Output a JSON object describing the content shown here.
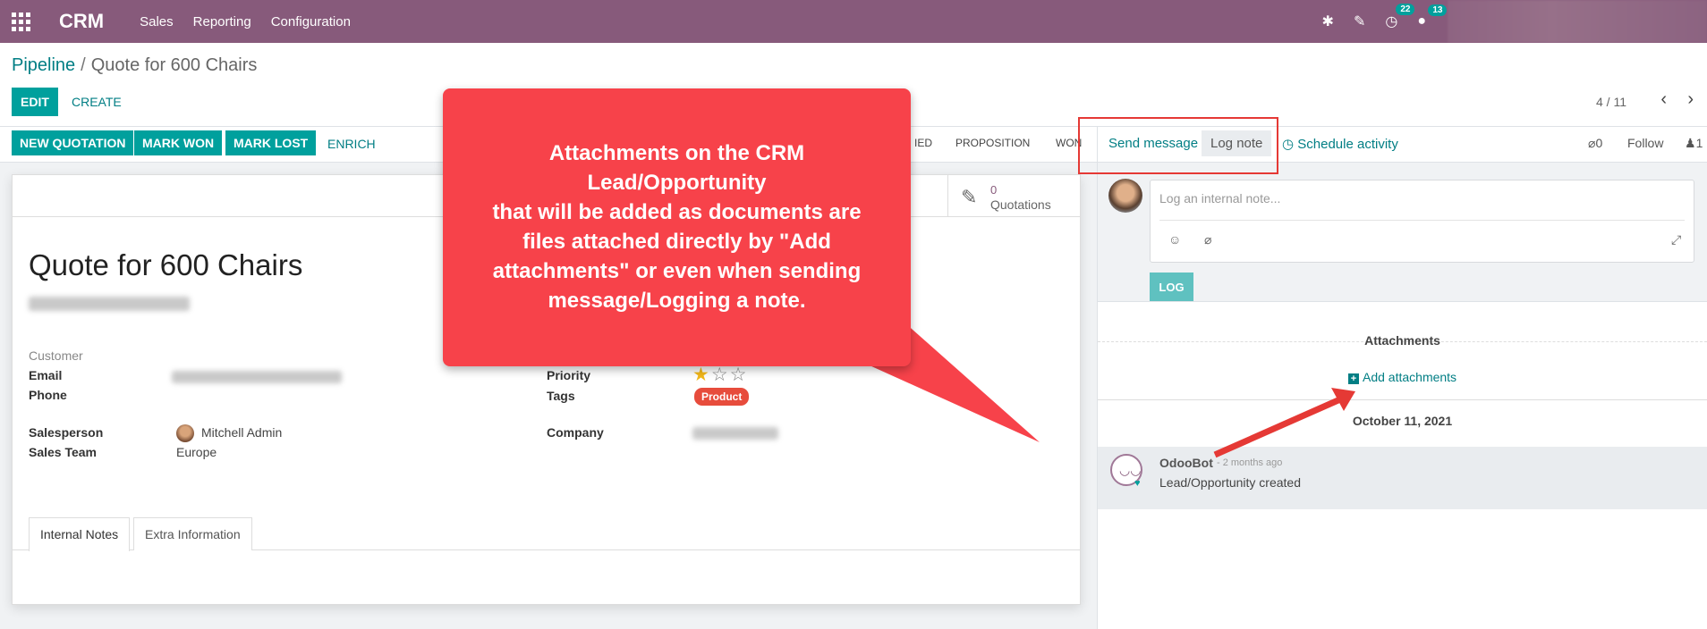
{
  "topnav": {
    "app_title": "CRM",
    "menu": [
      "Sales",
      "Reporting",
      "Configuration"
    ],
    "activity_count": "22",
    "message_count": "13"
  },
  "control": {
    "breadcrumb_parent": "Pipeline",
    "breadcrumb_current": "Quote for 600 Chairs",
    "edit_label": "EDIT",
    "create_label": "CREATE",
    "pager": "4 / 11"
  },
  "actions": {
    "new_quotation": "NEW QUOTATION",
    "mark_won": "MARK WON",
    "mark_lost": "MARK LOST",
    "enrich": "ENRICH"
  },
  "stages": [
    "IED",
    "PROPOSITION",
    "WON"
  ],
  "form": {
    "smart_button": {
      "count": "0",
      "label": "Quotations"
    },
    "title": "Quote for 600 Chairs",
    "customer_label": "Customer",
    "email_label": "Email",
    "phone_label": "Phone",
    "salesperson_label": "Salesperson",
    "salesperson_value": "Mitchell Admin",
    "sales_team_label": "Sales Team",
    "sales_team_value": "Europe",
    "priority_label": "Priority",
    "tags_label": "Tags",
    "tag_value": "Product",
    "company_label": "Company",
    "priority_stars": 1,
    "tabs": [
      "Internal Notes",
      "Extra Information"
    ]
  },
  "chatter": {
    "send_message": "Send message",
    "log_note": "Log note",
    "schedule_activity": "Schedule activity",
    "attachment_count": "0",
    "follow": "Follow",
    "follower_count": "1",
    "placeholder": "Log an internal note...",
    "log_button": "LOG",
    "attachments_title": "Attachments",
    "add_attachments": "Add attachments",
    "date": "October 11, 2021",
    "message": {
      "author": "OdooBot",
      "time": "- 2 months ago",
      "body": "Lead/Opportunity created"
    }
  },
  "annotation": {
    "lines": [
      "Attachments on the CRM",
      "Lead/Opportunity",
      "that will be added as documents are",
      "files attached directly by \"Add",
      "attachments\" or even when sending",
      "message/Logging a note."
    ]
  },
  "colors": {
    "brand": "#875a7b",
    "accent": "#00a09d",
    "callout": "#f7424a"
  }
}
